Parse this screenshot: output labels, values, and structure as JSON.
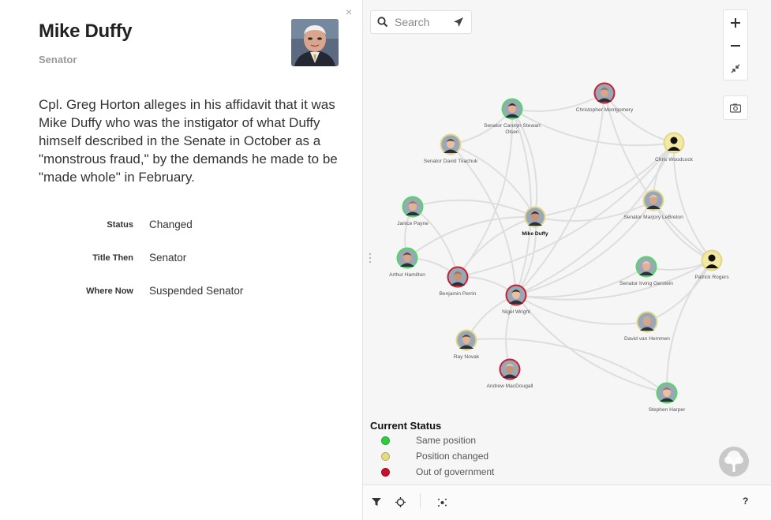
{
  "detail": {
    "close_glyph": "×",
    "name": "Mike Duffy",
    "role": "Senator",
    "description": "Cpl. Greg Horton alleges in his affidavit that it was Mike Duffy who was the instigator of what Duffy himself described in the Senate in October as a \"monstrous fraud,\" by the demands he made to be \"made whole\" in February.",
    "fields": [
      {
        "label": "Status",
        "value": "Changed"
      },
      {
        "label": "Title Then",
        "value": "Senator"
      },
      {
        "label": "Where Now",
        "value": "Suspended Senator"
      }
    ]
  },
  "search": {
    "placeholder": "Search",
    "value": ""
  },
  "zoom": {
    "in_glyph": "+",
    "out_glyph": "−"
  },
  "legend": {
    "title": "Current Status",
    "items": [
      {
        "label": "Same position",
        "color": "#2ecc40"
      },
      {
        "label": "Position changed",
        "color": "#e3db86"
      },
      {
        "label": "Out of government",
        "color": "#c8102e"
      }
    ]
  },
  "toolbar": {
    "help_label": "?"
  },
  "colors": {
    "same": "#4cd964",
    "changed": "#e1d68a",
    "out": "#c9202f",
    "none": "#e1d68a",
    "edge": "#dedede"
  },
  "nodes": [
    {
      "id": "montgomery",
      "label": "Christopher Montgomery",
      "status": "out",
      "silhouette": false
    },
    {
      "id": "olsen",
      "label": "Senator Carolyn Stewart Olsen",
      "status": "same",
      "silhouette": false
    },
    {
      "id": "woodcock",
      "label": "Chris Woodcock",
      "status": "changed",
      "silhouette": true
    },
    {
      "id": "tkachuk",
      "label": "Senator David Tkachuk",
      "status": "changed",
      "silhouette": false
    },
    {
      "id": "lebreton",
      "label": "Senator Marjory LeBreton",
      "status": "changed",
      "silhouette": false
    },
    {
      "id": "payne",
      "label": "Janice Payne",
      "status": "same",
      "silhouette": false
    },
    {
      "id": "duffy",
      "label": "Mike Duffy",
      "status": "changed",
      "silhouette": false
    },
    {
      "id": "rogers",
      "label": "Patrick Rogers",
      "status": "changed",
      "silhouette": true
    },
    {
      "id": "hamilton",
      "label": "Arthur Hamilton",
      "status": "same",
      "silhouette": false
    },
    {
      "id": "gerstein",
      "label": "Senator Irving Gerstein",
      "status": "same",
      "silhouette": false
    },
    {
      "id": "perrin",
      "label": "Benjamin Perrin",
      "status": "out",
      "silhouette": false
    },
    {
      "id": "wright",
      "label": "Nigel Wright",
      "status": "out",
      "silhouette": false
    },
    {
      "id": "hemmen",
      "label": "David van Hemmen",
      "status": "changed",
      "silhouette": false
    },
    {
      "id": "novak",
      "label": "Ray Novak",
      "status": "changed",
      "silhouette": false
    },
    {
      "id": "macdougall",
      "label": "Andrew MacDougall",
      "status": "out",
      "silhouette": false
    },
    {
      "id": "harper",
      "label": "Stephen Harper",
      "status": "same",
      "silhouette": false
    }
  ],
  "edges": [
    [
      "wright",
      "duffy"
    ],
    [
      "wright",
      "woodcock"
    ],
    [
      "wright",
      "rogers"
    ],
    [
      "wright",
      "gerstein"
    ],
    [
      "wright",
      "hemmen"
    ],
    [
      "wright",
      "novak"
    ],
    [
      "wright",
      "macdougall"
    ],
    [
      "wright",
      "harper"
    ],
    [
      "wright",
      "lebreton"
    ],
    [
      "wright",
      "olsen"
    ],
    [
      "wright",
      "tkachuk"
    ],
    [
      "wright",
      "perrin"
    ],
    [
      "wright",
      "montgomery"
    ],
    [
      "duffy",
      "olsen"
    ],
    [
      "duffy",
      "tkachuk"
    ],
    [
      "duffy",
      "perrin"
    ],
    [
      "duffy",
      "payne"
    ],
    [
      "duffy",
      "woodcock"
    ],
    [
      "duffy",
      "lebreton"
    ],
    [
      "duffy",
      "hamilton"
    ],
    [
      "perrin",
      "payne"
    ],
    [
      "perrin",
      "hamilton"
    ],
    [
      "perrin",
      "olsen"
    ],
    [
      "perrin",
      "woodcock"
    ],
    [
      "payne",
      "hamilton"
    ],
    [
      "olsen",
      "montgomery"
    ],
    [
      "olsen",
      "woodcock"
    ],
    [
      "montgomery",
      "woodcock"
    ],
    [
      "montgomery",
      "rogers"
    ],
    [
      "woodcock",
      "rogers"
    ],
    [
      "woodcock",
      "lebreton"
    ],
    [
      "gerstein",
      "rogers"
    ],
    [
      "lebreton",
      "rogers"
    ],
    [
      "rogers",
      "harper"
    ],
    [
      "hemmen",
      "rogers"
    ],
    [
      "tkachuk",
      "olsen"
    ],
    [
      "harper",
      "novak"
    ]
  ]
}
